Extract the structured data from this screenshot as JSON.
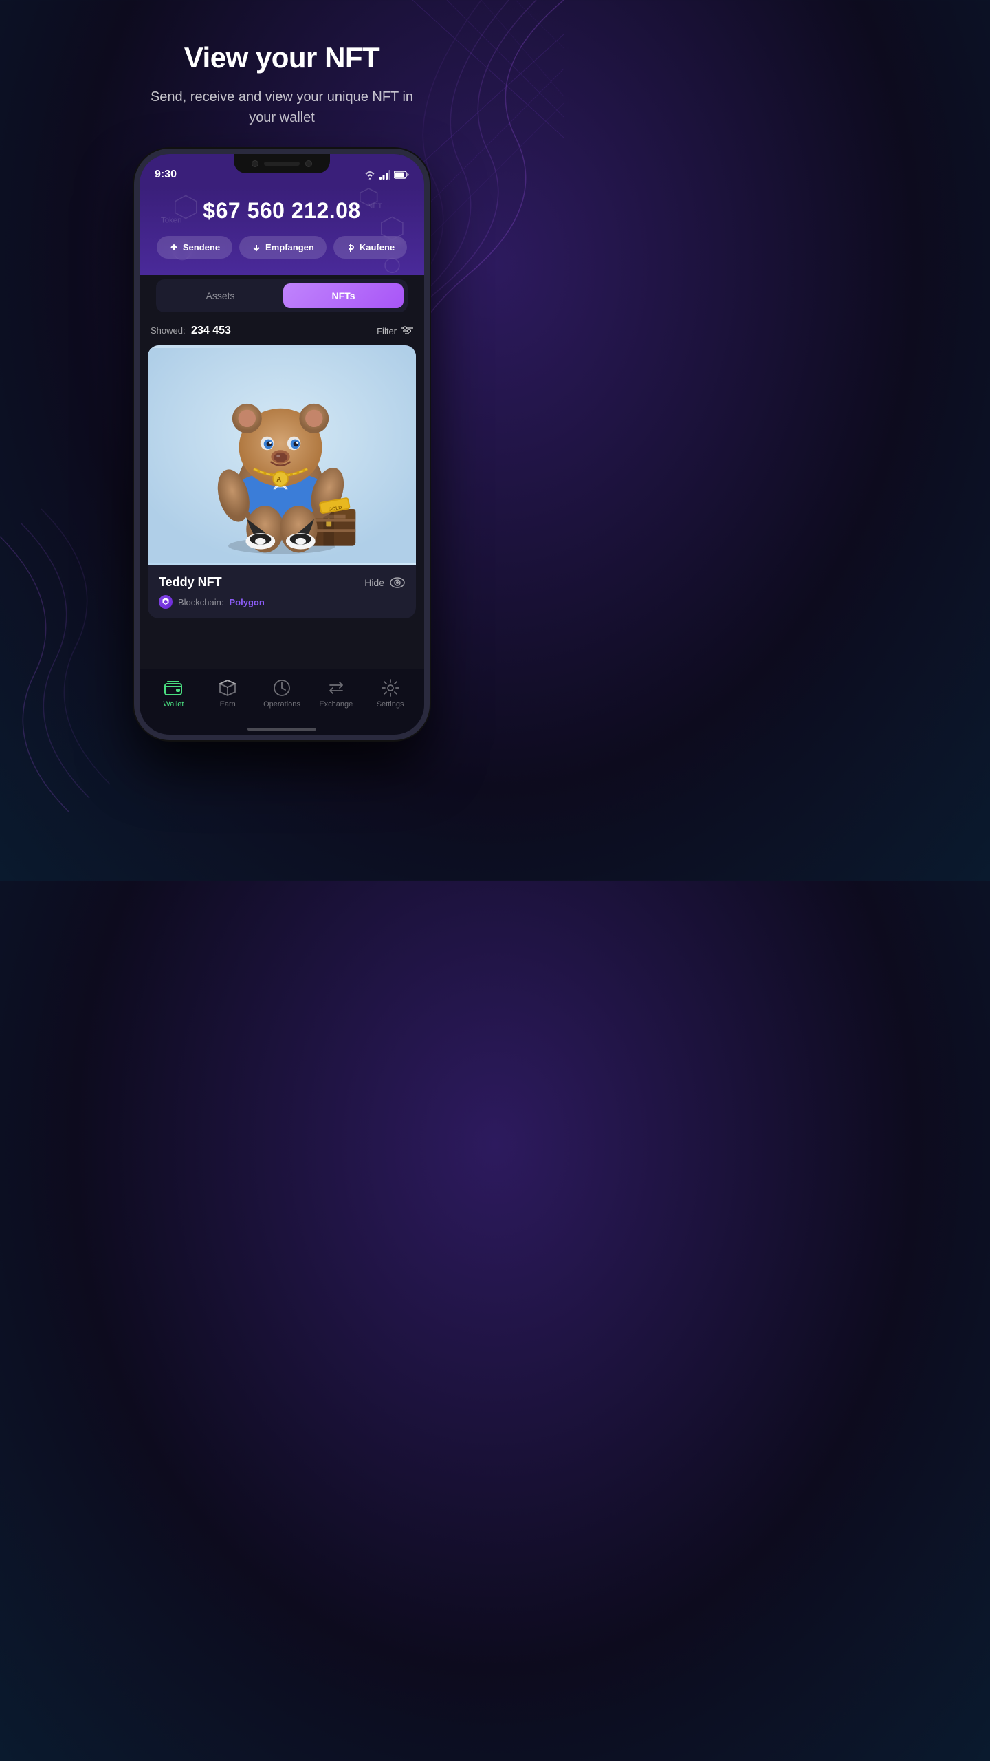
{
  "hero": {
    "title": "View your NFT",
    "subtitle": "Send, receive and view your unique NFT in your wallet"
  },
  "status_bar": {
    "time": "9:30",
    "icons": [
      "wifi",
      "signal",
      "battery"
    ]
  },
  "wallet": {
    "amount": "$67 560 212.08",
    "buttons": {
      "send": "Sendene",
      "receive": "Empfangen",
      "buy": "Kaufene"
    }
  },
  "tabs": {
    "assets": "Assets",
    "nfts": "NFTs",
    "active": "nfts"
  },
  "filter": {
    "showed_label": "Showed:",
    "showed_count": "234 453",
    "filter_label": "Filter"
  },
  "nft": {
    "name": "Teddy NFT",
    "hide_label": "Hide",
    "blockchain_label": "Blockchain:",
    "blockchain_name": "Polygon"
  },
  "nav": {
    "items": [
      {
        "id": "wallet",
        "label": "Wallet",
        "active": true
      },
      {
        "id": "earn",
        "label": "Earn",
        "active": false
      },
      {
        "id": "operations",
        "label": "Operations",
        "active": false
      },
      {
        "id": "exchange",
        "label": "Exchange",
        "active": false
      },
      {
        "id": "settings",
        "label": "Settings",
        "active": false
      }
    ]
  },
  "colors": {
    "accent": "#8b5cf6",
    "active_nav": "#4ade80",
    "background": "#0d0b1e"
  }
}
